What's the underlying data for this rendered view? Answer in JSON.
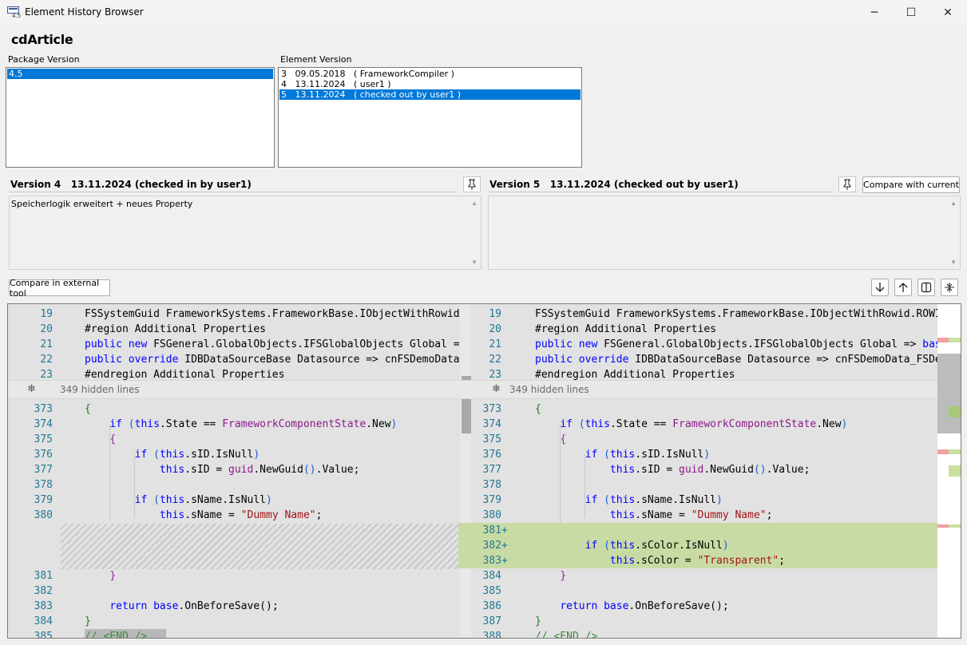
{
  "window": {
    "title": "Element History Browser",
    "icon_name": "app-icon",
    "icon_text": "4.5",
    "controls": {
      "minimize": "─",
      "maximize": "☐",
      "close": "✕"
    }
  },
  "heading": "cdArticle",
  "package_version": {
    "label": "Package Version",
    "items": [
      "4.5"
    ],
    "selected_index": 0
  },
  "element_version": {
    "label": "Element Version",
    "items": [
      "3   09.05.2018   ( FrameworkCompiler )",
      "4   13.11.2024   ( user1 )",
      "5   13.11.2024   ( checked out by user1 )"
    ],
    "selected_index": 2
  },
  "left_version": {
    "header": "Version 4   13.11.2024 (checked in by user1)",
    "comment": "Speicherlogik erweitert + neues Property"
  },
  "right_version": {
    "header": "Version 5   13.11.2024 (checked out by user1)",
    "comment": ""
  },
  "buttons": {
    "compare_current": "Compare with current",
    "compare_external": "Compare in external tool"
  },
  "toolbar_icons": [
    "arrow-down-icon",
    "arrow-up-icon",
    "split-view-icon",
    "collapse-unchanged-icon"
  ],
  "diff": {
    "hidden_lines_text": "349 hidden lines",
    "left_top_lines": [
      "19",
      "20",
      "21",
      "22",
      "23"
    ],
    "left_bottom_lines": [
      "373",
      "374",
      "375",
      "376",
      "377",
      "378",
      "379",
      "380",
      "381",
      "382",
      "383",
      "384",
      "385"
    ],
    "right_top_lines": [
      "19",
      "20",
      "21",
      "22",
      "23"
    ],
    "right_bottom_lines": [
      "373",
      "374",
      "375",
      "376",
      "377",
      "378",
      "379",
      "380",
      "381",
      "382",
      "383",
      "384",
      "385",
      "386",
      "387",
      "388"
    ],
    "added_marker": "+",
    "colors": {
      "added": "#c9dba4",
      "keyword": "#0000ff",
      "type": "#8a1a8a",
      "string": "#a31515",
      "comment": "#3a8a3a"
    }
  }
}
